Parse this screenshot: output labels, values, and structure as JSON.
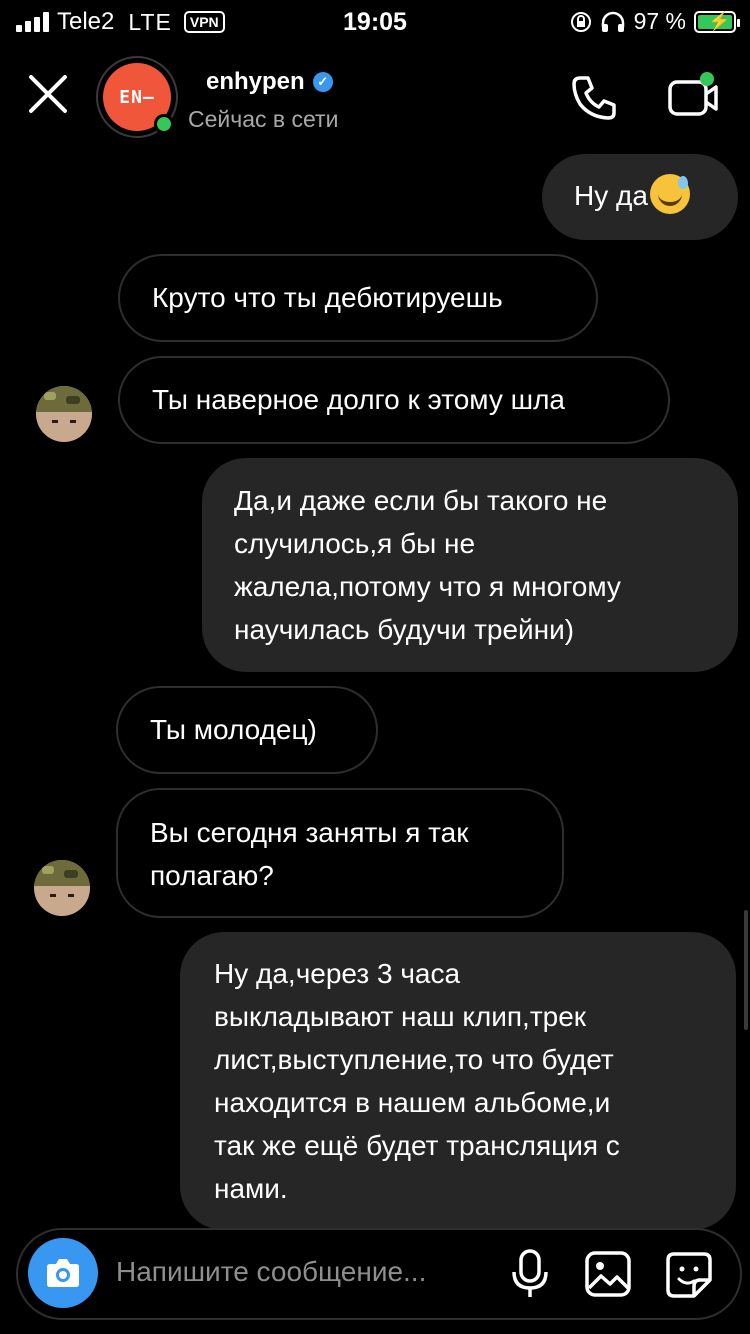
{
  "status_bar": {
    "carrier": "Tele2",
    "network": "LTE",
    "vpn": "VPN",
    "time": "19:05",
    "battery": "97 %"
  },
  "header": {
    "avatar_text": "EN—",
    "name": "enhypen",
    "status": "Сейчас в сети"
  },
  "messages": [
    {
      "from": "me",
      "text": "Ну да"
    },
    {
      "from": "them",
      "text": "Круто что ты дебютируешь"
    },
    {
      "from": "them",
      "text": "Ты наверное долго к этому шла"
    },
    {
      "from": "me",
      "lines": [
        "Да,и даже если бы такого не",
        "случилось,я бы не",
        "жалела,потому что я многому",
        "научилась будучи трейни)"
      ]
    },
    {
      "from": "them",
      "text": "Ты молодец)"
    },
    {
      "from": "them",
      "lines": [
        "Вы сегодня заняты я так",
        "полагаю?"
      ]
    },
    {
      "from": "me",
      "lines": [
        "Ну да,через 3 часа",
        "выкладывают наш клип,трек",
        "лист,выступление,то что будет",
        "находится в нашем альбоме,и",
        "так же ещё будет трансляция с",
        "нами."
      ]
    }
  ],
  "composer": {
    "placeholder": "Напишите сообщение..."
  },
  "colors": {
    "background": "#000000",
    "sent_bubble": "#262626",
    "accent_blue": "#3897f0",
    "online_green": "#34c759",
    "brand_orange": "#f0563a"
  },
  "icons": [
    "signal-icon",
    "vpn-icon",
    "lock-rotation-icon",
    "headphones-icon",
    "battery-icon",
    "close-icon",
    "verified-icon",
    "phone-icon",
    "video-icon",
    "camera-icon",
    "microphone-icon",
    "gallery-icon",
    "sticker-icon"
  ]
}
